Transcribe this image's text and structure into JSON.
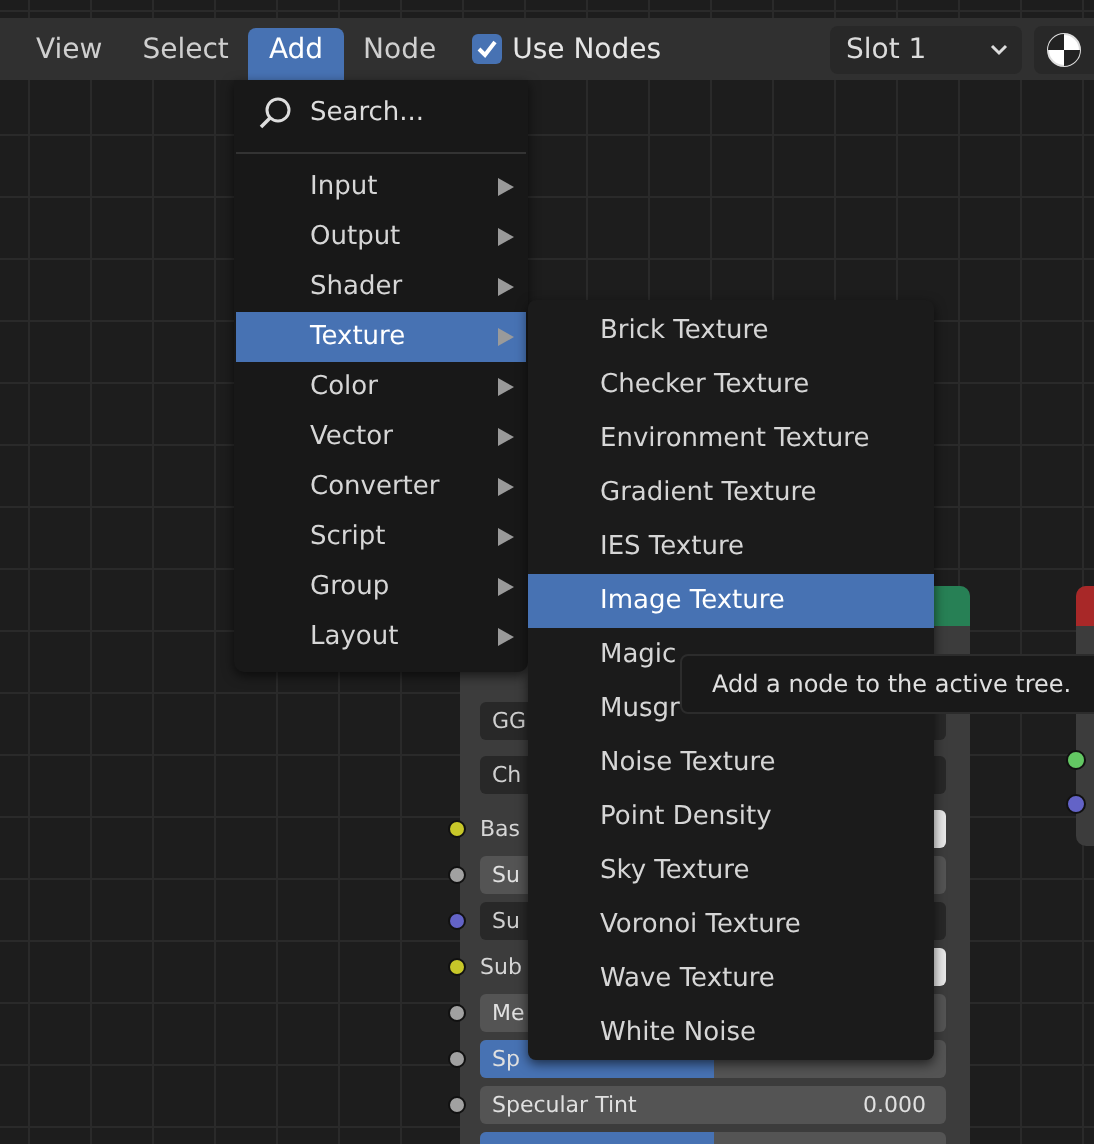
{
  "header": {
    "menus": [
      {
        "label": "View",
        "selected": false
      },
      {
        "label": "Select",
        "selected": false
      },
      {
        "label": "Add",
        "selected": true
      },
      {
        "label": "Node",
        "selected": false
      }
    ],
    "use_nodes": {
      "label": "Use Nodes",
      "checked": true
    },
    "slot": {
      "value": "Slot 1"
    }
  },
  "add_menu": {
    "search": "Search...",
    "items": [
      {
        "label": "Input",
        "selected": false
      },
      {
        "label": "Output",
        "selected": false
      },
      {
        "label": "Shader",
        "selected": false
      },
      {
        "label": "Texture",
        "selected": true
      },
      {
        "label": "Color",
        "selected": false
      },
      {
        "label": "Vector",
        "selected": false
      },
      {
        "label": "Converter",
        "selected": false
      },
      {
        "label": "Script",
        "selected": false
      },
      {
        "label": "Group",
        "selected": false
      },
      {
        "label": "Layout",
        "selected": false
      }
    ]
  },
  "texture_menu": {
    "items": [
      {
        "label": "Brick Texture",
        "selected": false
      },
      {
        "label": "Checker Texture",
        "selected": false
      },
      {
        "label": "Environment Texture",
        "selected": false
      },
      {
        "label": "Gradient Texture",
        "selected": false
      },
      {
        "label": "IES Texture",
        "selected": false
      },
      {
        "label": "Image Texture",
        "selected": true
      },
      {
        "label": "Magic",
        "selected": false
      },
      {
        "label": "Musgr",
        "selected": false
      },
      {
        "label": "Noise Texture",
        "selected": false
      },
      {
        "label": "Point Density",
        "selected": false
      },
      {
        "label": "Sky Texture",
        "selected": false
      },
      {
        "label": "Voronoi Texture",
        "selected": false
      },
      {
        "label": "Wave Texture",
        "selected": false
      },
      {
        "label": "White Noise",
        "selected": false
      }
    ]
  },
  "tooltip": {
    "text": "Add a node to the active tree."
  },
  "node": {
    "rows": [
      {
        "kind": "dropdown",
        "label": "GG"
      },
      {
        "kind": "dropdown",
        "label": "Ch"
      },
      {
        "kind": "color",
        "label": "Bas",
        "color": "#c7c729"
      },
      {
        "kind": "slider",
        "label": "Su",
        "level": 0,
        "color": "#a1a1a1"
      },
      {
        "kind": "dropdown",
        "label": "Su",
        "color": "#6363c7"
      },
      {
        "kind": "color",
        "label": "Sub",
        "color": "#c7c729"
      },
      {
        "kind": "slider",
        "label": "Me",
        "level": 0,
        "color": "#a1a1a1"
      },
      {
        "kind": "slider",
        "label": "Sp",
        "level": 0.5,
        "color": "#a1a1a1"
      },
      {
        "kind": "slider",
        "label": "Specular Tint",
        "value": "0.000",
        "level": 0,
        "color": "#a1a1a1"
      },
      {
        "kind": "slider",
        "level": 0.5
      }
    ]
  },
  "right_node": {
    "sockets": [
      {
        "color": "#63c763"
      },
      {
        "color": "#6363c7"
      }
    ]
  }
}
